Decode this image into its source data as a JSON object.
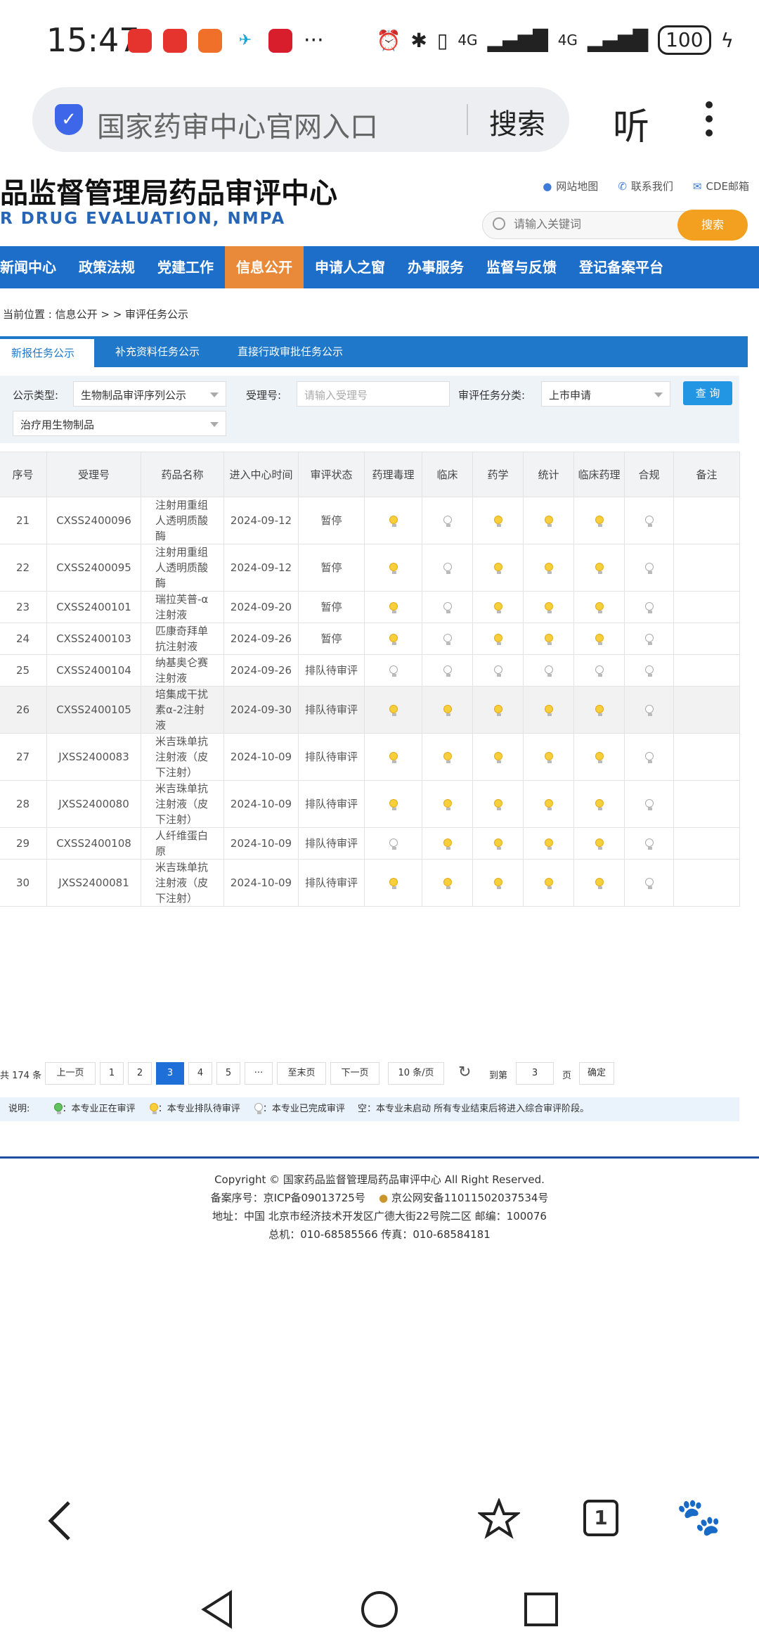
{
  "status": {
    "time": "15:47",
    "more": "···",
    "network1": "4G",
    "network2": "4G",
    "battery": "100"
  },
  "browser": {
    "query": "国家药审中心官网入口",
    "search_label": "搜索",
    "listen_label": "听"
  },
  "header": {
    "title": "品监督管理局药品审评中心",
    "subtitle": "R DRUG EVALUATION, NMPA",
    "links": [
      "网站地图",
      "联系我们",
      "CDE邮箱"
    ],
    "search_placeholder": "请输入关键词",
    "search_button": "搜索"
  },
  "nav": [
    "新闻中心",
    "政策法规",
    "党建工作",
    "信息公开",
    "申请人之窗",
    "办事服务",
    "监督与反馈",
    "登记备案平台"
  ],
  "breadcrumb": "当前位置 : 信息公开 > > 审评任务公示",
  "tabs": [
    "新报任务公示",
    "补充资料任务公示",
    "直接行政审批任务公示"
  ],
  "filters": {
    "type_label": "公示类型:",
    "type_value": "生物制品审评序列公示",
    "accept_label": "受理号:",
    "accept_placeholder": "请输入受理号",
    "category_label": "审评任务分类:",
    "category_value": "上市申请",
    "sub_value": "治疗用生物制品",
    "query_button": "查 询"
  },
  "table": {
    "headers": [
      "序号",
      "受理号",
      "药品名称",
      "进入中心时间",
      "审评状态",
      "药理毒理",
      "临床",
      "药学",
      "统计",
      "临床药理",
      "合规",
      "备注"
    ],
    "rows": [
      {
        "no": "21",
        "id": "CXSS2400096",
        "name": "注射用重组人透明质酸酶",
        "date": "2024-09-12",
        "status": "暂停",
        "b": [
          "y",
          "w",
          "y",
          "y",
          "y",
          "w"
        ]
      },
      {
        "no": "22",
        "id": "CXSS2400095",
        "name": "注射用重组人透明质酸酶",
        "date": "2024-09-12",
        "status": "暂停",
        "b": [
          "y",
          "w",
          "y",
          "y",
          "y",
          "w"
        ]
      },
      {
        "no": "23",
        "id": "CXSS2400101",
        "name": "瑞拉芙普-α注射液",
        "date": "2024-09-20",
        "status": "暂停",
        "b": [
          "y",
          "w",
          "y",
          "y",
          "y",
          "w"
        ]
      },
      {
        "no": "24",
        "id": "CXSS2400103",
        "name": "匹康奇拜单抗注射液",
        "date": "2024-09-26",
        "status": "暂停",
        "b": [
          "y",
          "w",
          "y",
          "y",
          "y",
          "w"
        ]
      },
      {
        "no": "25",
        "id": "CXSS2400104",
        "name": "纳基奥仑赛注射液",
        "date": "2024-09-26",
        "status": "排队待审评",
        "b": [
          "w",
          "w",
          "w",
          "w",
          "w",
          "w"
        ]
      },
      {
        "no": "26",
        "id": "CXSS2400105",
        "name": "培集成干扰素α-2注射液",
        "date": "2024-09-30",
        "status": "排队待审评",
        "b": [
          "y",
          "y",
          "y",
          "y",
          "y",
          "w"
        ]
      },
      {
        "no": "27",
        "id": "JXSS2400083",
        "name": "米吉珠单抗注射液（皮下注射）",
        "date": "2024-10-09",
        "status": "排队待审评",
        "b": [
          "y",
          "y",
          "y",
          "y",
          "y",
          "w"
        ]
      },
      {
        "no": "28",
        "id": "JXSS2400080",
        "name": "米吉珠单抗注射液（皮下注射）",
        "date": "2024-10-09",
        "status": "排队待审评",
        "b": [
          "y",
          "y",
          "y",
          "y",
          "y",
          "w"
        ]
      },
      {
        "no": "29",
        "id": "CXSS2400108",
        "name": "人纤维蛋白原",
        "date": "2024-10-09",
        "status": "排队待审评",
        "b": [
          "w",
          "y",
          "y",
          "y",
          "y",
          "w"
        ]
      },
      {
        "no": "30",
        "id": "JXSS2400081",
        "name": "米吉珠单抗注射液（皮下注射）",
        "date": "2024-10-09",
        "status": "排队待审评",
        "b": [
          "y",
          "y",
          "y",
          "y",
          "y",
          "w"
        ]
      }
    ]
  },
  "pager": {
    "total": "共 174 条",
    "prev": "上一页",
    "pages": [
      "1",
      "2",
      "3",
      "4",
      "5"
    ],
    "ellipsis": "···",
    "last": "至末页",
    "next": "下一页",
    "per_page": "10 条/页",
    "goto": "到第",
    "goto_value": "3",
    "page_unit": "页",
    "confirm": "确定"
  },
  "legend": {
    "label": "说明:",
    "green": "：本专业正在审评",
    "yellow": "：本专业排队待审评",
    "white": "：本专业已完成审评",
    "rest": "空：本专业未启动    所有专业结束后将进入综合审评阶段。"
  },
  "footer": {
    "line1": "Copyright © 国家药品监督管理局药品审评中心   All Right Reserved.",
    "line2a": "备案序号：京ICP备09013725号",
    "line2b": "京公网安备11011502037534号",
    "line3": "地址：中国 北京市经济技术开发区广德大街22号院二区      邮编：100076",
    "line4": "总机：010-68585566      传真：010-68584181"
  },
  "bottom": {
    "tab_count": "1"
  },
  "colors": {
    "nav": "#1d6ec9",
    "nav_active": "#e9893a",
    "search_orange": "#f3a021",
    "pager_active": "#1f6fd8"
  }
}
